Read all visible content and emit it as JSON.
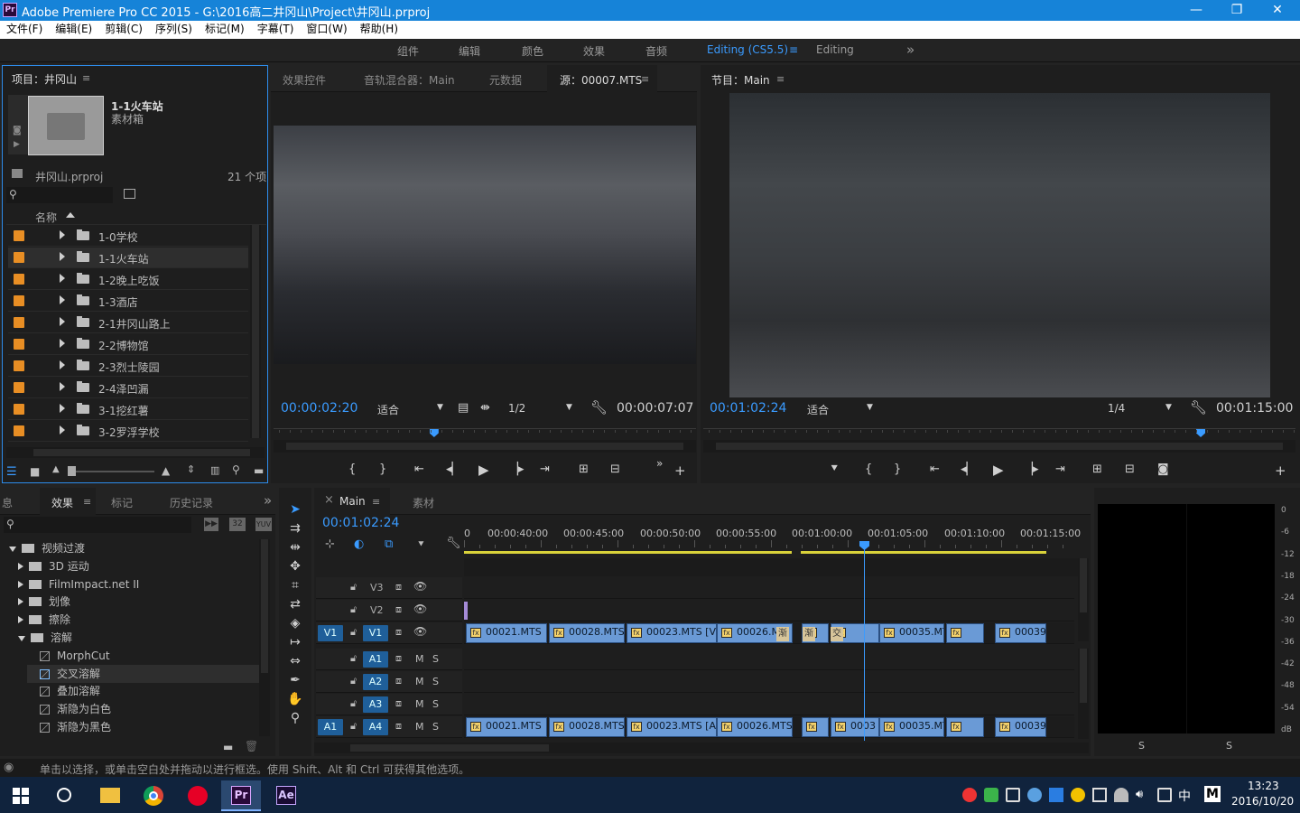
{
  "window": {
    "title": "Adobe Premiere Pro CC 2015 - G:\\2016高二井冈山\\Project\\井冈山.prproj",
    "logo": "Pr",
    "min": "—",
    "max": "❐",
    "close": "✕"
  },
  "menu": [
    "文件(F)",
    "编辑(E)",
    "剪辑(C)",
    "序列(S)",
    "标记(M)",
    "字幕(T)",
    "窗口(W)",
    "帮助(H)"
  ],
  "workspaces": {
    "items": [
      "组件",
      "编辑",
      "颜色",
      "效果",
      "音频"
    ],
    "active": "Editing (CS5.5)",
    "menu": "≡",
    "editing": "Editing",
    "more": "»"
  },
  "project": {
    "title": "项目：井冈山",
    "menu": "≡",
    "bin_name": "1-1火车站",
    "bin_type": "素材箱",
    "file": "井冈山.prproj",
    "count": "21 个项",
    "col_name": "名称",
    "items": [
      {
        "label": "1-0学校"
      },
      {
        "label": "1-1火车站",
        "selected": true
      },
      {
        "label": "1-2晚上吃饭"
      },
      {
        "label": "1-3酒店"
      },
      {
        "label": "2-1井冈山路上"
      },
      {
        "label": "2-2博物馆"
      },
      {
        "label": "2-3烈士陵园"
      },
      {
        "label": "2-4泽凹漏"
      },
      {
        "label": "3-1挖红薯"
      },
      {
        "label": "3-2罗浮学校"
      }
    ]
  },
  "source": {
    "tabs": [
      "效果控件",
      "音轨混合器：Main",
      "元数据",
      "源：00007.MTS"
    ],
    "menu": "≡",
    "timecode": "00:00:02:20",
    "fit": "适合",
    "resolution": "1/2",
    "duration": "00:00:07:07",
    "playhead": 0.38
  },
  "program": {
    "tab": "节目：Main",
    "menu": "≡",
    "timecode": "00:01:02:24",
    "fit": "适合",
    "resolution": "1/4",
    "duration": "00:01:15:00",
    "playhead": 0.84
  },
  "effects": {
    "tabs": [
      "息",
      "效果",
      "标记",
      "历史记录"
    ],
    "active": "效果",
    "menu": "≡",
    "more": "»",
    "badge1": "32",
    "badge2": "YUV",
    "tree": [
      {
        "label": "视频过渡",
        "level": 0,
        "type": "open"
      },
      {
        "label": "3D 运动",
        "level": 1,
        "type": "closed"
      },
      {
        "label": "FilmImpact.net II",
        "level": 1,
        "type": "closed"
      },
      {
        "label": "划像",
        "level": 1,
        "type": "closed"
      },
      {
        "label": "擦除",
        "level": 1,
        "type": "closed"
      },
      {
        "label": "溶解",
        "level": 1,
        "type": "open"
      },
      {
        "label": "MorphCut",
        "level": 2,
        "type": "fx"
      },
      {
        "label": "交叉溶解",
        "level": 2,
        "type": "fx",
        "selected": true
      },
      {
        "label": "叠加溶解",
        "level": 2,
        "type": "fx"
      },
      {
        "label": "渐隐为白色",
        "level": 2,
        "type": "fx"
      },
      {
        "label": "渐隐为黑色",
        "level": 2,
        "type": "fx"
      }
    ]
  },
  "timeline": {
    "tabs": [
      "Main",
      "素材"
    ],
    "close": "×",
    "menu": "≡",
    "timecode": "00:01:02:24",
    "ruler": [
      "0",
      "00:00:40:00",
      "00:00:45:00",
      "00:00:50:00",
      "00:00:55:00",
      "00:01:00:00",
      "00:01:05:00",
      "00:01:10:00",
      "00:01:15:00"
    ],
    "tracks": {
      "V3": "V3",
      "V2": "V2",
      "V1": "V1",
      "A1": "A1",
      "A2": "A2",
      "A3": "A3",
      "A4": "A4",
      "src_v": "V1",
      "src_a": "A1",
      "M": "M",
      "S": "S"
    },
    "video_clips": [
      {
        "name": "00021.MTS"
      },
      {
        "name": "00028.MTS"
      },
      {
        "name": "00023.MTS [V]"
      },
      {
        "name": "00026.M"
      },
      {
        "name": ""
      },
      {
        "name": "00035.MT"
      },
      {
        "name": ""
      },
      {
        "name": "00039"
      }
    ],
    "audio_clips": [
      {
        "name": "00021.MTS"
      },
      {
        "name": "00028.MTS"
      },
      {
        "name": "00023.MTS [A]"
      },
      {
        "name": "00026.MTS"
      },
      {
        "name": ""
      },
      {
        "name": "0003"
      },
      {
        "name": "00035.MT"
      },
      {
        "name": ""
      },
      {
        "name": "00039"
      }
    ],
    "trans_label": "渐",
    "trans_label2": "交"
  },
  "meters": {
    "scale": [
      "0",
      "-6",
      "-12",
      "-18",
      "-24",
      "-30",
      "-36",
      "-42",
      "-48",
      "-54",
      "dB"
    ],
    "s_left": "S",
    "s_right": "S"
  },
  "status": {
    "text": "单击以选择，或单击空白处并拖动以进行框选。使用 Shift、Alt 和 Ctrl 可获得其他选项。"
  },
  "taskbar": {
    "ime": "中",
    "ime2": "M",
    "time": "13:23",
    "date": "2016/10/20",
    "pr": "Pr",
    "ae": "Ae"
  },
  "colors": {
    "accent": "#3a9bff",
    "label_orange": "#e88e24",
    "clip_blue": "#6a9ad6",
    "titlebar": "#1683d8"
  }
}
